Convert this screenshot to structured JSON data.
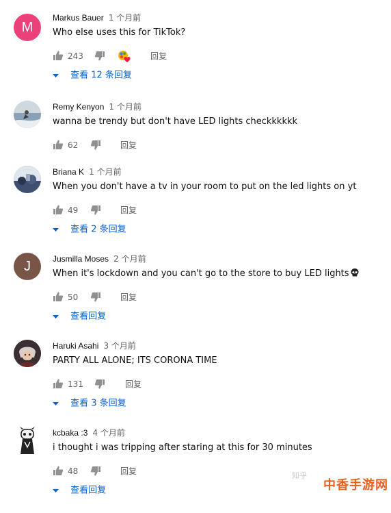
{
  "comments": [
    {
      "author": "Markus Bauer",
      "time": "1 个月前",
      "text": "Who else uses this for TikTok?",
      "likes": "243",
      "reply": "回复",
      "replies": "查看 12 条回复",
      "avatar_letter": "M",
      "avatar_color": "#ec407a"
    },
    {
      "author": "Remy Kenyon",
      "time": "1 个月前",
      "text": "wanna be trendy but don't have LED lights checkkkkkk",
      "likes": "62",
      "reply": "回复",
      "replies": ""
    },
    {
      "author": "Briana K",
      "time": "1 个月前",
      "text": "When you don't have a tv in your room to put on the led lights on yt",
      "likes": "49",
      "reply": "回复",
      "replies": "查看 2 条回复"
    },
    {
      "author": "Jusmilla Moses",
      "time": "2 个月前",
      "text": "When it's lockdown and you can't go to the store to buy LED lights",
      "likes": "50",
      "reply": "回复",
      "replies": "查看回复",
      "avatar_letter": "J",
      "avatar_color": "#795548"
    },
    {
      "author": "Haruki Asahi",
      "time": "3 个月前",
      "text": "PARTY ALL ALONE; ITS CORONA TIME",
      "likes": "131",
      "reply": "回复",
      "replies": "查看 3 条回复"
    },
    {
      "author": "kcbaka :3",
      "time": "4 个月前",
      "text": "i thought i was tripping after staring at this for 30 minutes",
      "likes": "48",
      "reply": "回复",
      "replies": "查看回复"
    }
  ],
  "watermark": "中香手游网",
  "zhihu": "知乎"
}
